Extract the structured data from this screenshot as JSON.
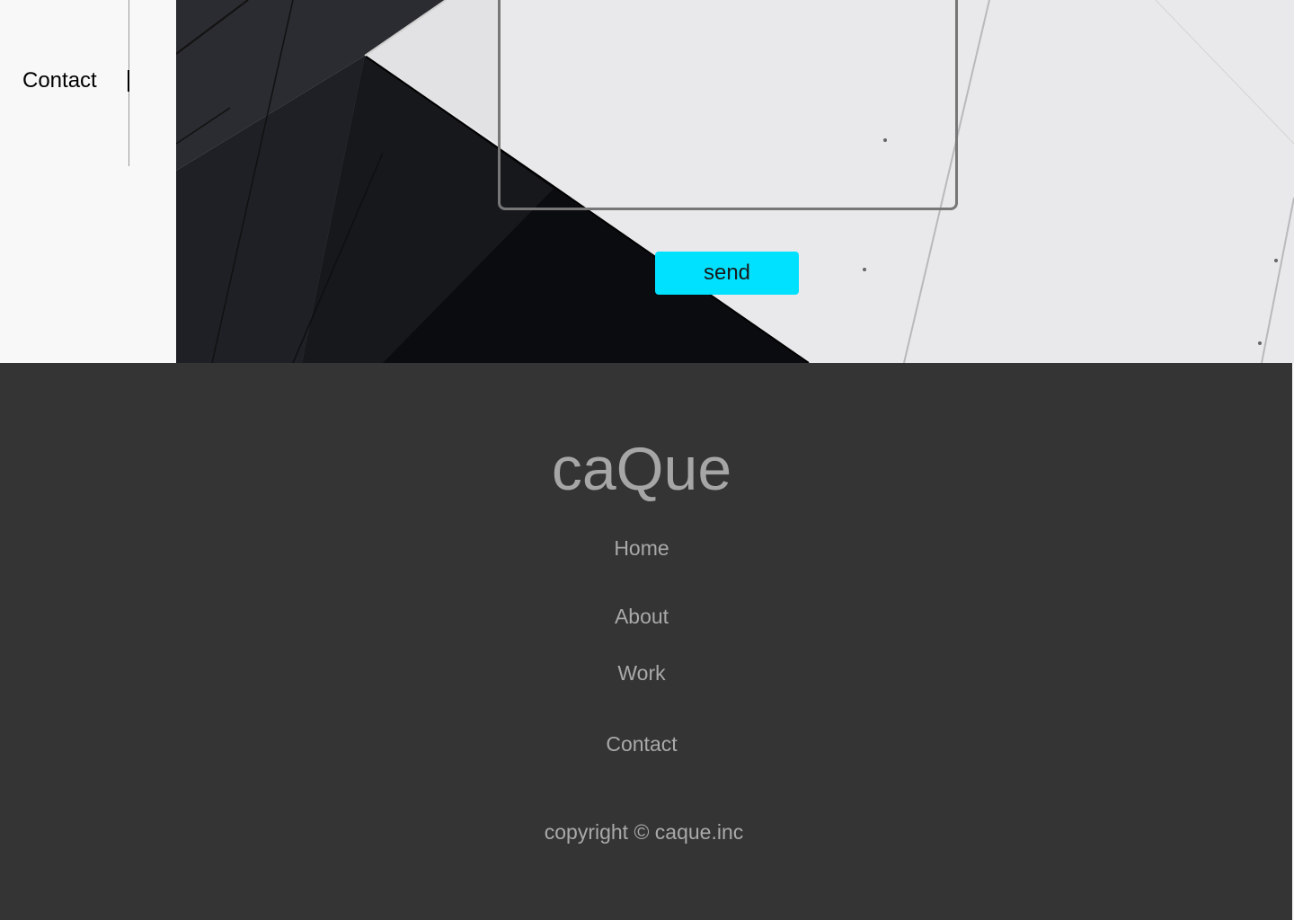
{
  "sidebar": {
    "active_item": "Contact"
  },
  "contact_form": {
    "message_placeholder": "",
    "send_label": "send"
  },
  "footer": {
    "brand": "caQue",
    "nav": [
      "Home",
      "About",
      "Work",
      "Contact"
    ],
    "copyright": "copyright © caque.inc"
  },
  "colors": {
    "accent": "#00e1ff",
    "footer_bg": "#343434",
    "footer_text": "#a9a9a9"
  }
}
